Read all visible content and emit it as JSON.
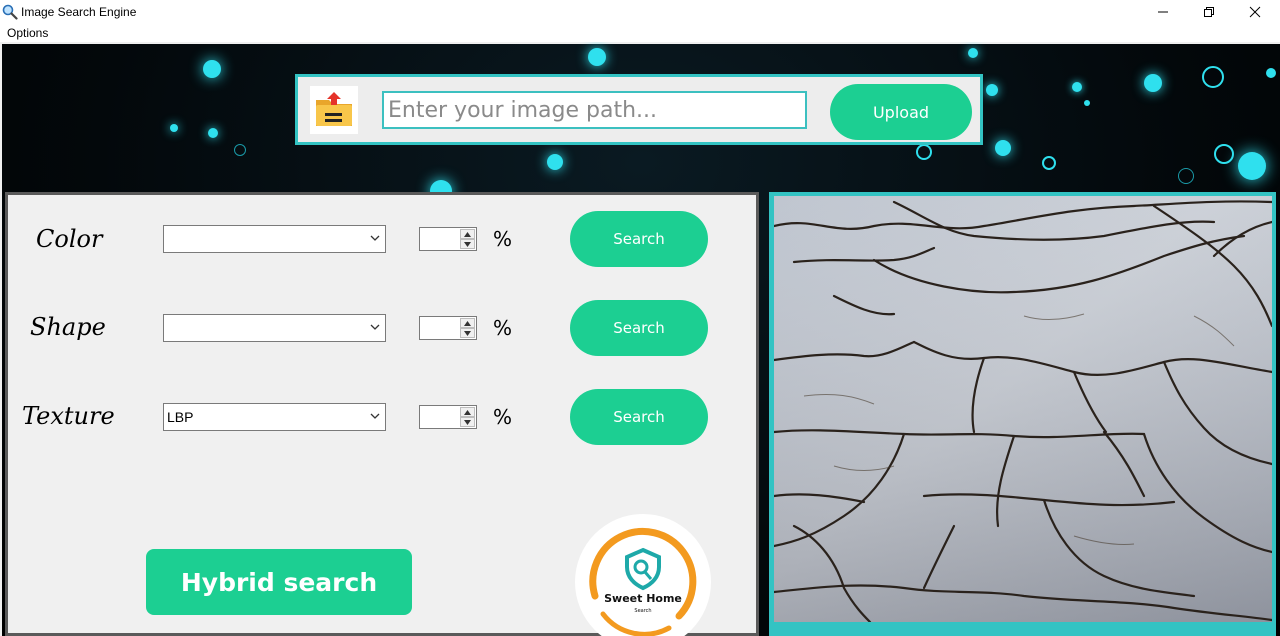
{
  "window": {
    "title": "Image Search Engine",
    "controls": [
      "minimize",
      "restore",
      "close"
    ]
  },
  "menu": {
    "items": [
      "Options"
    ]
  },
  "upload_bar": {
    "folder_icon": "upload-folder-icon",
    "path_placeholder": "Enter your image path...",
    "path_value": "",
    "upload_label": "Upload"
  },
  "features": [
    {
      "label": "Color",
      "selected": "",
      "percent": "",
      "unit": "%",
      "search_label": "Search"
    },
    {
      "label": "Shape",
      "selected": "",
      "percent": "",
      "unit": "%",
      "search_label": "Search"
    },
    {
      "label": "Texture",
      "selected": "LBP",
      "percent": "",
      "unit": "%",
      "search_label": "Search"
    }
  ],
  "hybrid_label": "Hybrid search",
  "logo": {
    "title": "Sweet Home",
    "subtitle": "Search"
  },
  "colors": {
    "accent": "#1ccf92",
    "border": "#33c3c3"
  },
  "preview": {
    "description_icon": "cracked-paint-texture-image"
  }
}
